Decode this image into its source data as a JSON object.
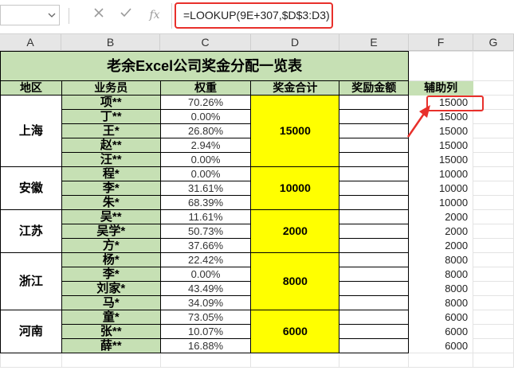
{
  "formula_bar": {
    "formula": "=LOOKUP(9E+307,$D$3:D3)",
    "cancel_icon": "cancel-x-icon",
    "enter_icon": "check-icon",
    "fx_label": "fx"
  },
  "columns": [
    "A",
    "B",
    "C",
    "D",
    "E",
    "F",
    "G"
  ],
  "sheet": {
    "title": "老余Excel公司奖金分配一览表",
    "headers": {
      "region": "地区",
      "person": "业务员",
      "weight": "权重",
      "total": "奖金合计",
      "bonus": "奖励金额",
      "helper": "辅助列"
    },
    "groups": [
      {
        "region": "上海",
        "total": "15000",
        "rows": [
          {
            "name": "项**",
            "weight": "70.26%",
            "helper": "15000"
          },
          {
            "name": "丁**",
            "weight": "0.00%",
            "helper": "15000"
          },
          {
            "name": "王*",
            "weight": "26.80%",
            "helper": "15000"
          },
          {
            "name": "赵**",
            "weight": "2.94%",
            "helper": "15000"
          },
          {
            "name": "汪**",
            "weight": "0.00%",
            "helper": "15000"
          }
        ]
      },
      {
        "region": "安徽",
        "total": "10000",
        "rows": [
          {
            "name": "程*",
            "weight": "0.00%",
            "helper": "10000"
          },
          {
            "name": "李*",
            "weight": "31.61%",
            "helper": "10000"
          },
          {
            "name": "朱*",
            "weight": "68.39%",
            "helper": "10000"
          }
        ]
      },
      {
        "region": "江苏",
        "total": "2000",
        "rows": [
          {
            "name": "吴**",
            "weight": "11.61%",
            "helper": "2000"
          },
          {
            "name": "吴学*",
            "weight": "50.73%",
            "helper": "2000"
          },
          {
            "name": "方*",
            "weight": "37.66%",
            "helper": "2000"
          }
        ]
      },
      {
        "region": "浙江",
        "total": "8000",
        "rows": [
          {
            "name": "杨*",
            "weight": "22.42%",
            "helper": "8000"
          },
          {
            "name": "李*",
            "weight": "0.00%",
            "helper": "8000"
          },
          {
            "name": "刘家*",
            "weight": "43.49%",
            "helper": "8000"
          },
          {
            "name": "马*",
            "weight": "34.09%",
            "helper": "8000"
          }
        ]
      },
      {
        "region": "河南",
        "total": "6000",
        "rows": [
          {
            "name": "童*",
            "weight": "73.05%",
            "helper": "6000"
          },
          {
            "name": "张**",
            "weight": "10.07%",
            "helper": "6000"
          },
          {
            "name": "薛**",
            "weight": "16.88%",
            "helper": "6000"
          }
        ]
      }
    ]
  },
  "colors": {
    "header_green": "#c6e0b4",
    "total_yellow": "#ffff00",
    "highlight_red": "#e8302b"
  }
}
